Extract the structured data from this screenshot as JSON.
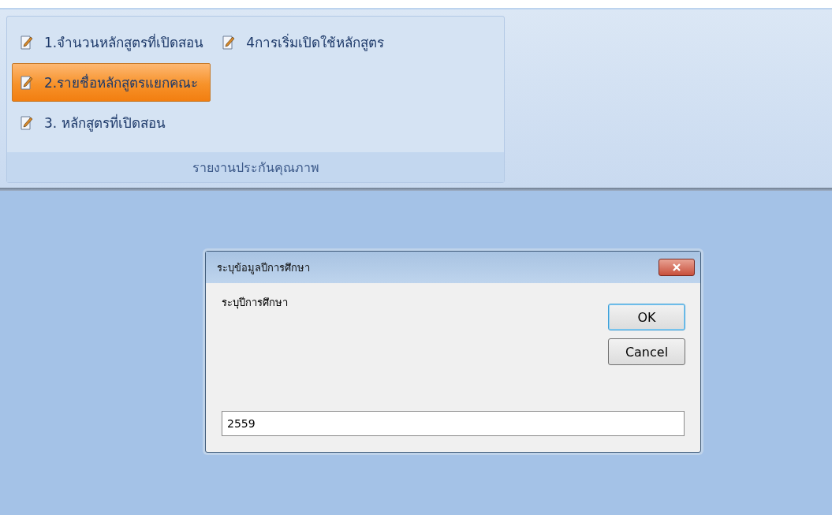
{
  "ribbon_group": {
    "columns": [
      {
        "items": [
          {
            "label": "1.จำนวนหลักสูตรที่เปิดสอน",
            "selected": false
          },
          {
            "label": "2.รายชื่อหลักสูตรแยกคณะ",
            "selected": true
          },
          {
            "label": "3. หลักสูตรที่เปิดสอน",
            "selected": false
          }
        ]
      },
      {
        "items": [
          {
            "label": "4การเริ่มเปิดใช้หลักสูตร",
            "selected": false
          }
        ]
      }
    ],
    "caption": "รายงานประกันคุณภาพ"
  },
  "dialog": {
    "title": "ระบุข้อมูลปีการศึกษา",
    "prompt": "ระบุปีการศึกษา",
    "buttons": [
      {
        "label": "OK",
        "default": true
      },
      {
        "label": "Cancel",
        "default": false
      }
    ],
    "input": {
      "value": "2559"
    }
  }
}
